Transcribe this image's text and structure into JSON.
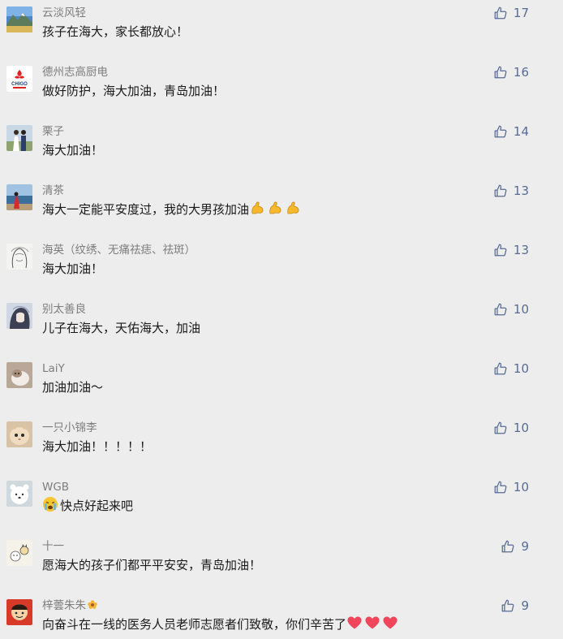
{
  "colors": {
    "background": "#ededed",
    "nickname": "#7d7d7d",
    "content": "#191919",
    "like": "#576b95"
  },
  "comments": [
    {
      "nickname": "云淡风轻",
      "content": "孩子在海大，家长都放心！",
      "likes": "17",
      "avatar_icon": "mountain-landscape-avatar"
    },
    {
      "nickname": "德州志高厨电",
      "content": "做好防护，海大加油，青岛加油！",
      "likes": "16",
      "avatar_icon": "chigo-logo-avatar",
      "logo_text": "CHIGO"
    },
    {
      "nickname": "栗子",
      "content": "海大加油！",
      "likes": "14",
      "avatar_icon": "couple-photo-avatar"
    },
    {
      "nickname": "清茶",
      "content": "海大一定能平安度过，我的大男孩加油",
      "emoji": [
        "flexed-biceps-icon",
        "flexed-biceps-icon",
        "flexed-biceps-icon"
      ],
      "likes": "13",
      "avatar_icon": "seaside-person-avatar"
    },
    {
      "nickname": "海英（纹绣、无痛祛痣、祛斑）",
      "content": "海大加油！",
      "likes": "13",
      "avatar_icon": "sketch-portrait-avatar"
    },
    {
      "nickname": "别太善良",
      "content": "儿子在海大，天佑海大，加油",
      "likes": "10",
      "avatar_icon": "anime-girl-avatar"
    },
    {
      "nickname": "LaiY",
      "content": "加油加油～",
      "likes": "10",
      "avatar_icon": "cat-photo-avatar"
    },
    {
      "nickname": "一只小锦李",
      "content": "海大加油！！！！！",
      "likes": "10",
      "avatar_icon": "fluffy-cat-avatar"
    },
    {
      "nickname": "WGB",
      "content": "快点好起来吧",
      "emoji_prefix": "loudly-crying-face-icon",
      "likes": "10",
      "avatar_icon": "white-bear-avatar"
    },
    {
      "nickname": "十一",
      "content": "愿海大的孩子们都平平安安，青岛加油！",
      "likes": "9",
      "avatar_icon": "cartoon-cats-avatar"
    },
    {
      "nickname": "梓蕓朱朱",
      "nickname_emoji": "flower-icon",
      "content": "向奋斗在一线的医务人员老师志愿者们致敬，你们辛苦了",
      "emoji": [
        "red-heart-icon",
        "red-heart-icon",
        "red-heart-icon"
      ],
      "likes": "9",
      "avatar_icon": "cartoon-kid-avatar"
    }
  ]
}
